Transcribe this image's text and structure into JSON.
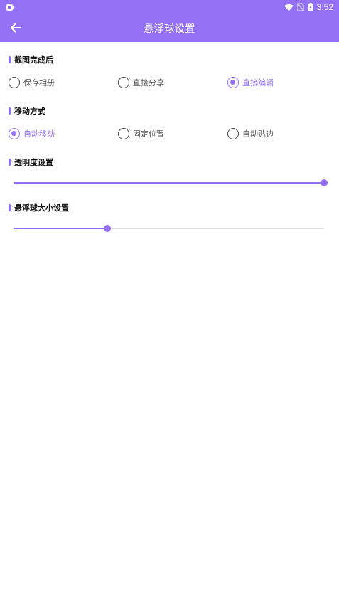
{
  "status_bar": {
    "time": "3:52"
  },
  "app_bar": {
    "title": "悬浮球设置"
  },
  "sections": {
    "after_screenshot": {
      "title": "截图完成后",
      "options": [
        "保存相册",
        "直接分享",
        "直接编辑"
      ],
      "selected": 2
    },
    "move_mode": {
      "title": "移动方式",
      "options": [
        "自动移动",
        "固定位置",
        "自动贴边"
      ],
      "selected": 0
    },
    "transparency": {
      "title": "透明度设置",
      "value": 1.0
    },
    "ball_size": {
      "title": "悬浮球大小设置",
      "value": 0.3
    }
  },
  "colors": {
    "accent": "#9370f4"
  }
}
